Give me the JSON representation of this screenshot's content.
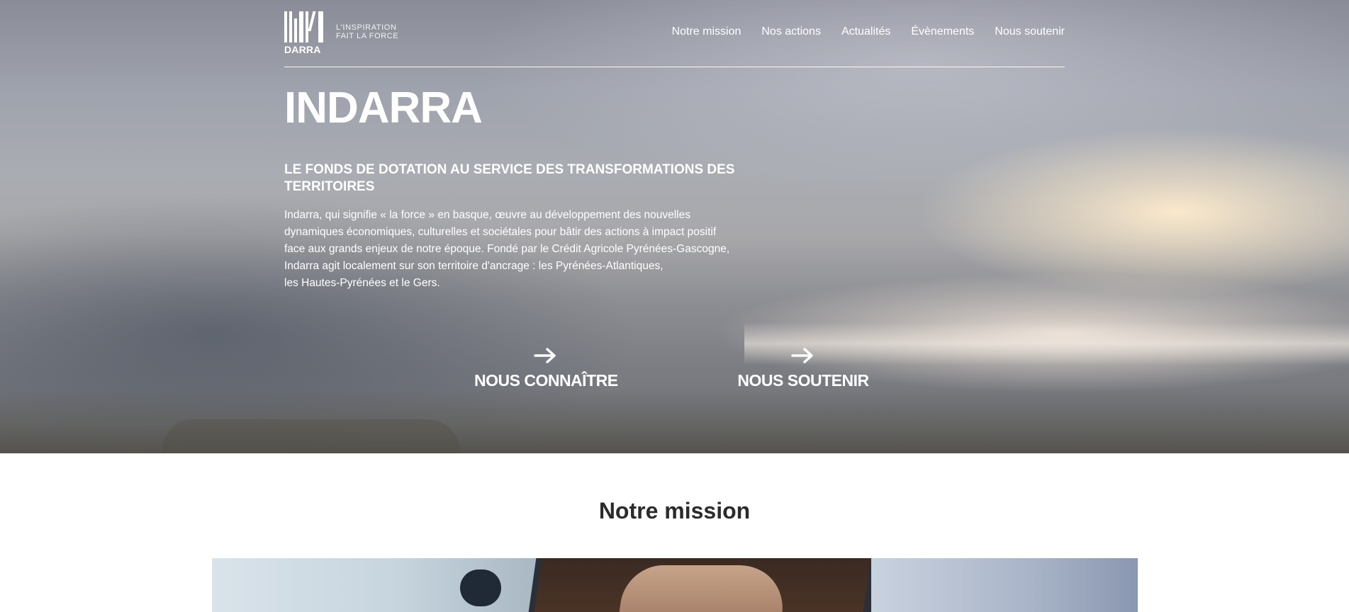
{
  "header": {
    "logo_word": "DARRA",
    "tagline": [
      "L'INSPIRATION",
      "FAIT LA FORCE"
    ],
    "nav": [
      "Notre mission",
      "Nos actions",
      "Actualités",
      "Évènements",
      "Nous soutenir"
    ]
  },
  "hero": {
    "title": "INDARRA",
    "subtitle": "LE FONDS DE DOTATION AU SERVICE DES TRANSFORMATIONS DES TERRITOIRES",
    "text_lines": [
      "Indarra, qui signifie « la force » en basque, œuvre au développement des nouvelles",
      "dynamiques économiques, culturelles et sociétales pour bâtir des actions à impact positif",
      "face aux grands enjeux de notre époque. Fondé par le Crédit Agricole Pyrénées-Gascogne,",
      "Indarra agit localement sur son territoire d'ancrage : les Pyrénées-Atlantiques,",
      "les Hautes-Pyrénées et le Gers."
    ],
    "cta_know": "NOUS CONNAÎTRE",
    "cta_support": "NOUS SOUTENIR"
  },
  "mission": {
    "title": "Notre mission"
  },
  "icons": {
    "cta_arrow": "arrow-right-icon",
    "logo": "indarra-logo"
  }
}
